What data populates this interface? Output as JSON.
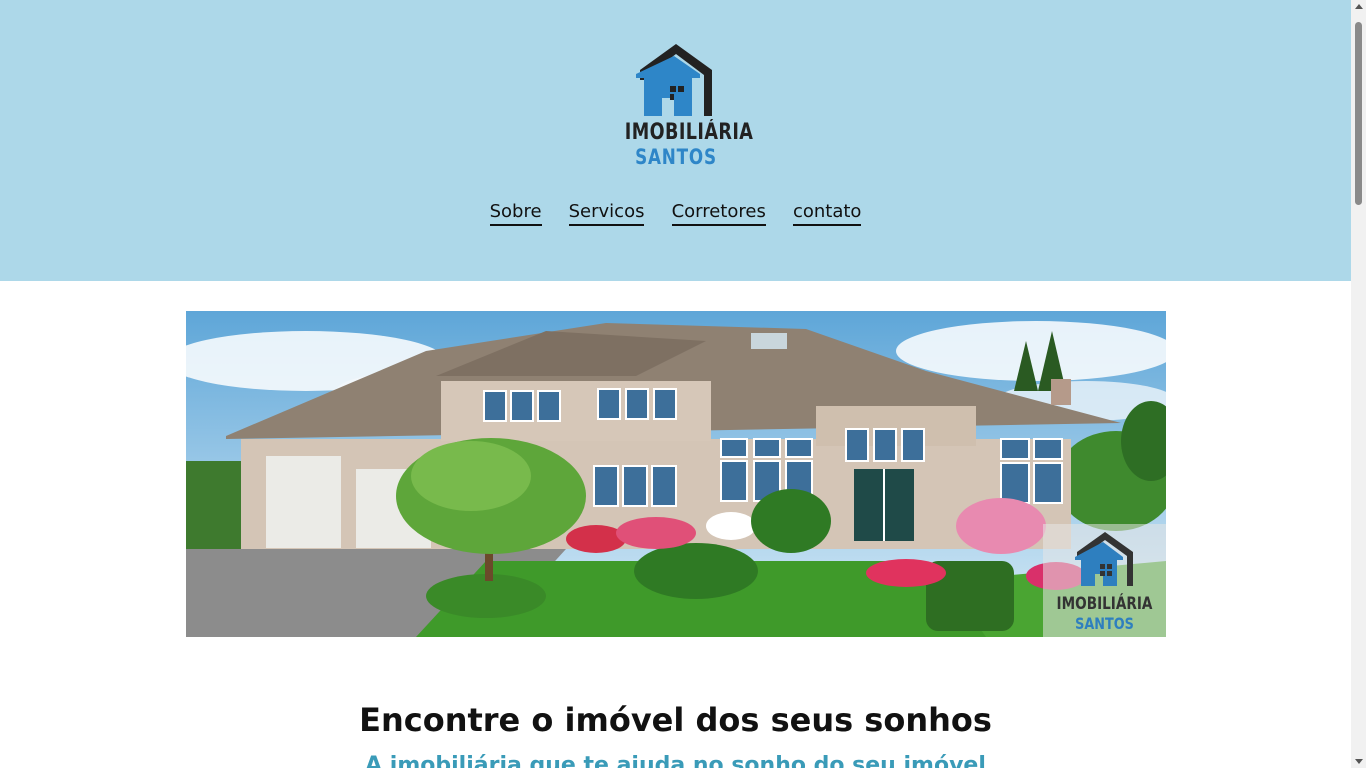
{
  "brand": {
    "line1": "IMOBILIÁRIA",
    "line2": "SANTOS",
    "colors": {
      "dark": "#222222",
      "blue": "#2e86c8"
    }
  },
  "nav": {
    "items": [
      {
        "label": "Sobre"
      },
      {
        "label": "Servicos"
      },
      {
        "label": "Corretores"
      },
      {
        "label": "contato"
      }
    ]
  },
  "hero": {
    "image": "house-photo",
    "watermark": {
      "line1": "IMOBILIÁRIA",
      "line2": "SANTOS"
    }
  },
  "main": {
    "headline": "Encontre o imóvel dos seus sonhos",
    "subheadline": "A imobiliária que te ajuda no sonho do seu imóvel"
  },
  "theme": {
    "header_bg": "#add8e9",
    "subheadline_color": "#3a9bb8"
  }
}
